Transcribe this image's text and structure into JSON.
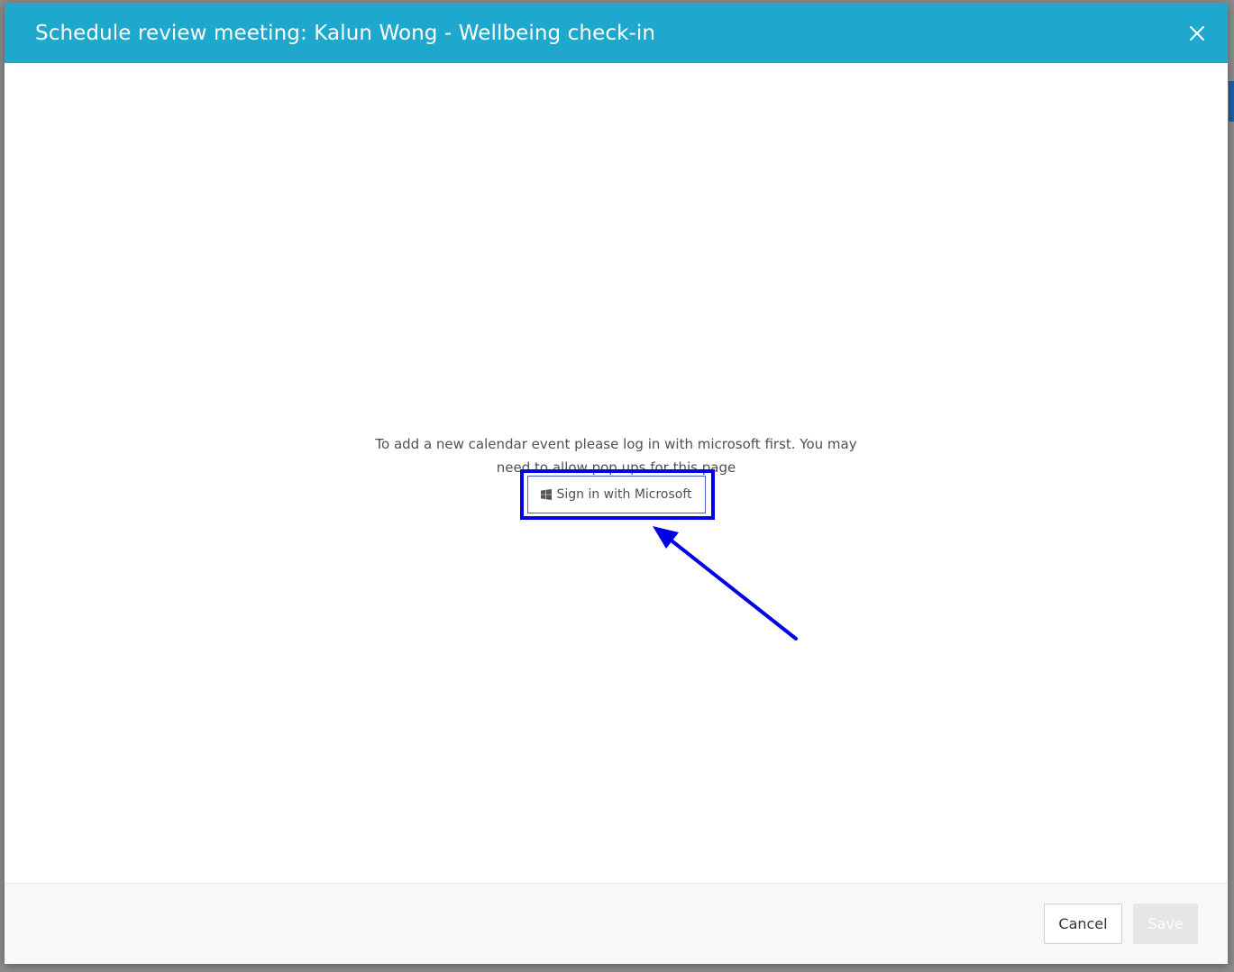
{
  "modal": {
    "title": "Schedule review meeting: Kalun Wong - Wellbeing check-in",
    "close_icon": "close-icon",
    "header_color": "#1fa8cd"
  },
  "body": {
    "prompt_text": "To add a new calendar event please log in with microsoft first. You may need to allow pop ups for this page",
    "sign_in_label": "Sign in with Microsoft",
    "sign_in_icon": "windows-icon"
  },
  "annotation": {
    "highlight_color": "#0000e6"
  },
  "footer": {
    "cancel_label": "Cancel",
    "save_label": "Save"
  }
}
